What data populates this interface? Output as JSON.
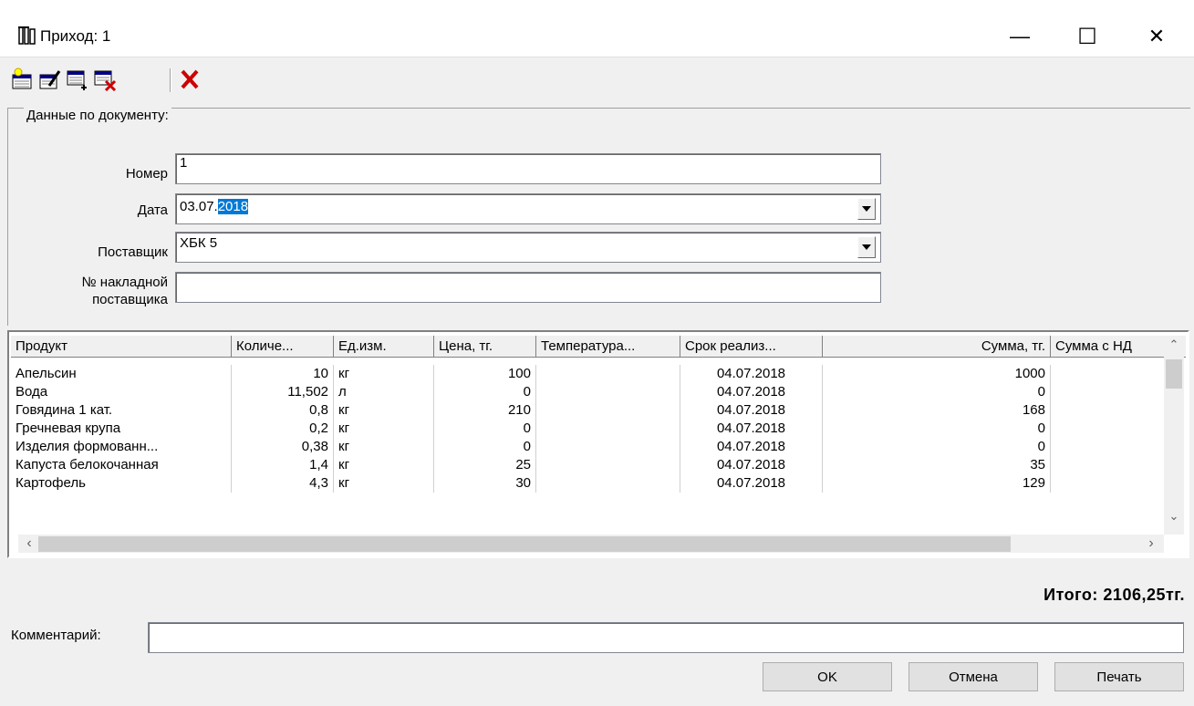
{
  "window": {
    "title": "Приход: 1",
    "minimize": "—",
    "maximize": "☐",
    "close": "✕"
  },
  "toolbar": {
    "icons": [
      "new-row-icon",
      "edit-row-icon",
      "add-row-icon",
      "remove-row-icon",
      "delete-icon"
    ],
    "delete_glyph": "✕"
  },
  "document": {
    "group_label": "Данные по документу:",
    "number_label": "Номер",
    "number_value": "1",
    "date_label": "Дата",
    "date_value_plain": "03.07.",
    "date_value_selected": "2018",
    "supplier_label": "Поставщик",
    "supplier_value": "ХБК 5",
    "invoice_label_line1": "№ накладной",
    "invoice_label_line2": "поставщика",
    "invoice_value": ""
  },
  "grid": {
    "columns": [
      "Продукт",
      "Количе...",
      "Ед.изм.",
      "Цена, тг.",
      "Температура...",
      "Срок реализ...",
      "Сумма, тг.",
      "Сумма с НД"
    ],
    "rows": [
      [
        "Апельсин",
        "10",
        "кг",
        "100",
        "",
        "04.07.2018",
        "1000",
        ""
      ],
      [
        "Вода",
        "11,502",
        "л",
        "0",
        "",
        "04.07.2018",
        "0",
        ""
      ],
      [
        "Говядина 1 кат.",
        "0,8",
        "кг",
        "210",
        "",
        "04.07.2018",
        "168",
        ""
      ],
      [
        "Гречневая крупа",
        "0,2",
        "кг",
        "0",
        "",
        "04.07.2018",
        "0",
        ""
      ],
      [
        "Изделия формованн...",
        "0,38",
        "кг",
        "0",
        "",
        "04.07.2018",
        "0",
        ""
      ],
      [
        "Капуста белокочанная",
        "1,4",
        "кг",
        "25",
        "",
        "04.07.2018",
        "35",
        ""
      ],
      [
        "Картофель",
        "4,3",
        "кг",
        "30",
        "",
        "04.07.2018",
        "129",
        ""
      ]
    ]
  },
  "footer": {
    "total": "Итого: 2106,25тг.",
    "comment_label": "Комментарий:",
    "comment_value": "",
    "ok": "OK",
    "cancel": "Отмена",
    "print": "Печать"
  },
  "colors": {
    "selection": "#0078d7",
    "delete_red": "#cc0000",
    "window_bg": "#f0f0f0"
  }
}
